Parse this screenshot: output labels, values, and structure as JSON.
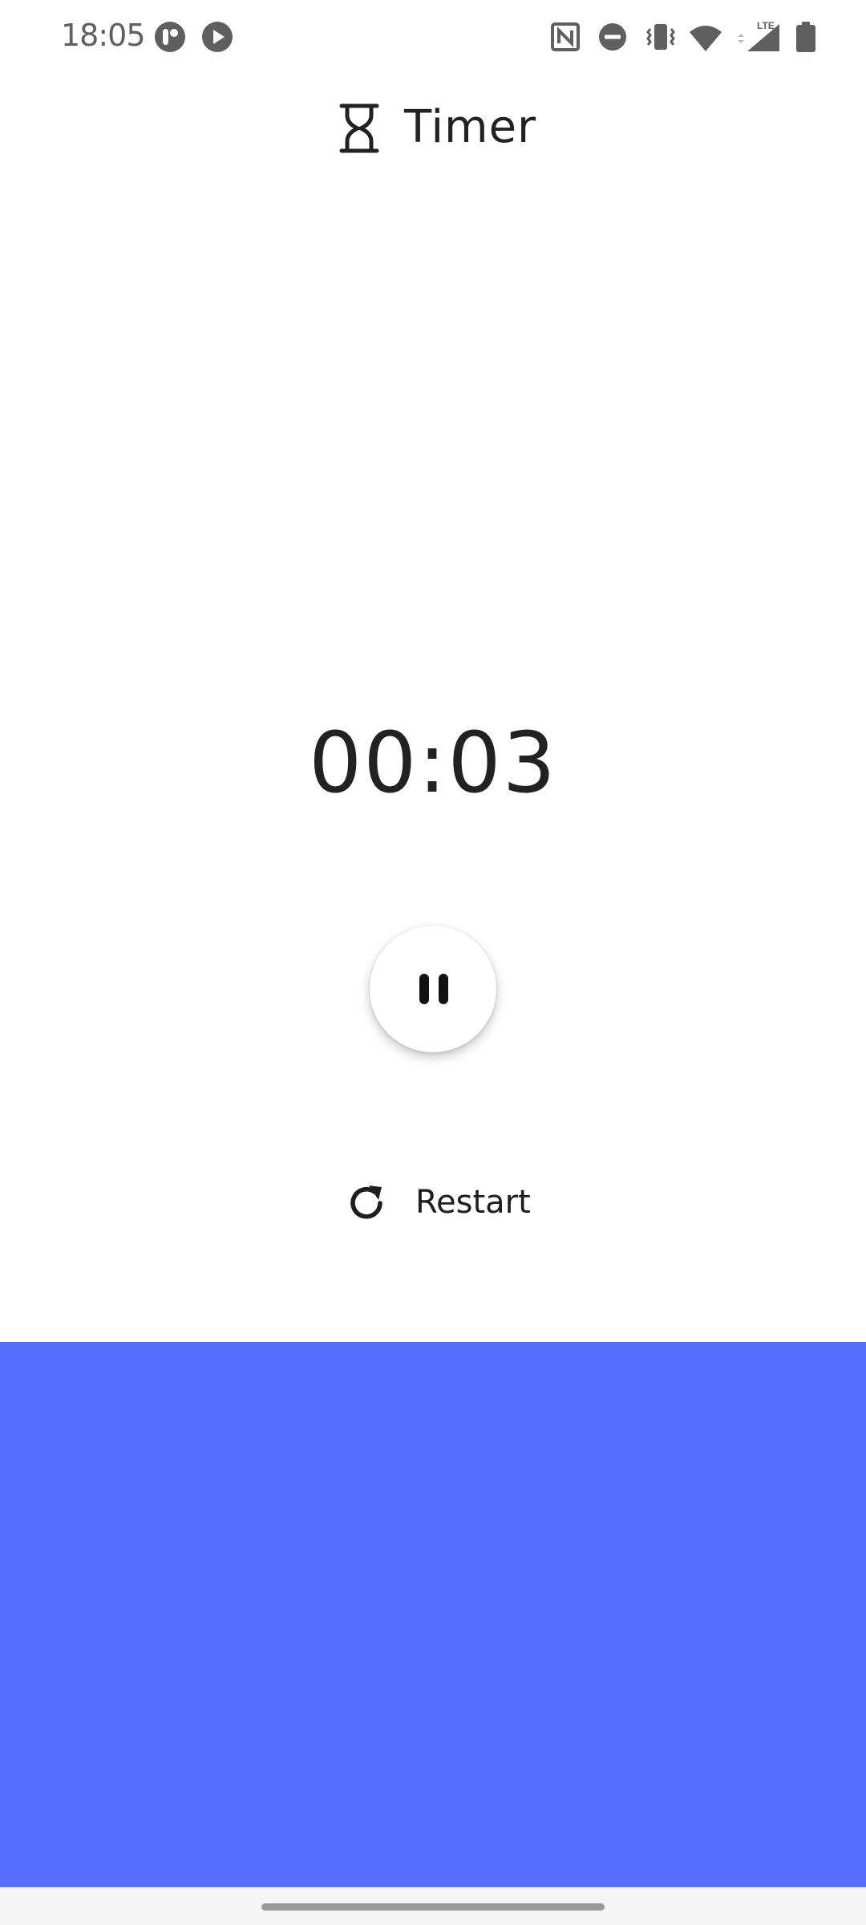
{
  "status_bar": {
    "time": "18:05",
    "left_icons": [
      "app-notification-icon",
      "play-notification-icon"
    ],
    "right_icons": [
      "nfc-icon",
      "do-not-disturb-icon",
      "vibrate-icon",
      "wifi-icon",
      "lte-signal-icon",
      "battery-icon"
    ],
    "network_label": "LTE"
  },
  "header": {
    "title": "Timer",
    "icon": "hourglass-icon"
  },
  "timer": {
    "display": "00:03"
  },
  "controls": {
    "pause_icon": "pause-icon",
    "restart_label": "Restart",
    "restart_icon": "restart-icon"
  },
  "colors": {
    "accent_blue": "#5570ff",
    "text_dark": "#222222",
    "status_grey": "#5f5f5f"
  }
}
